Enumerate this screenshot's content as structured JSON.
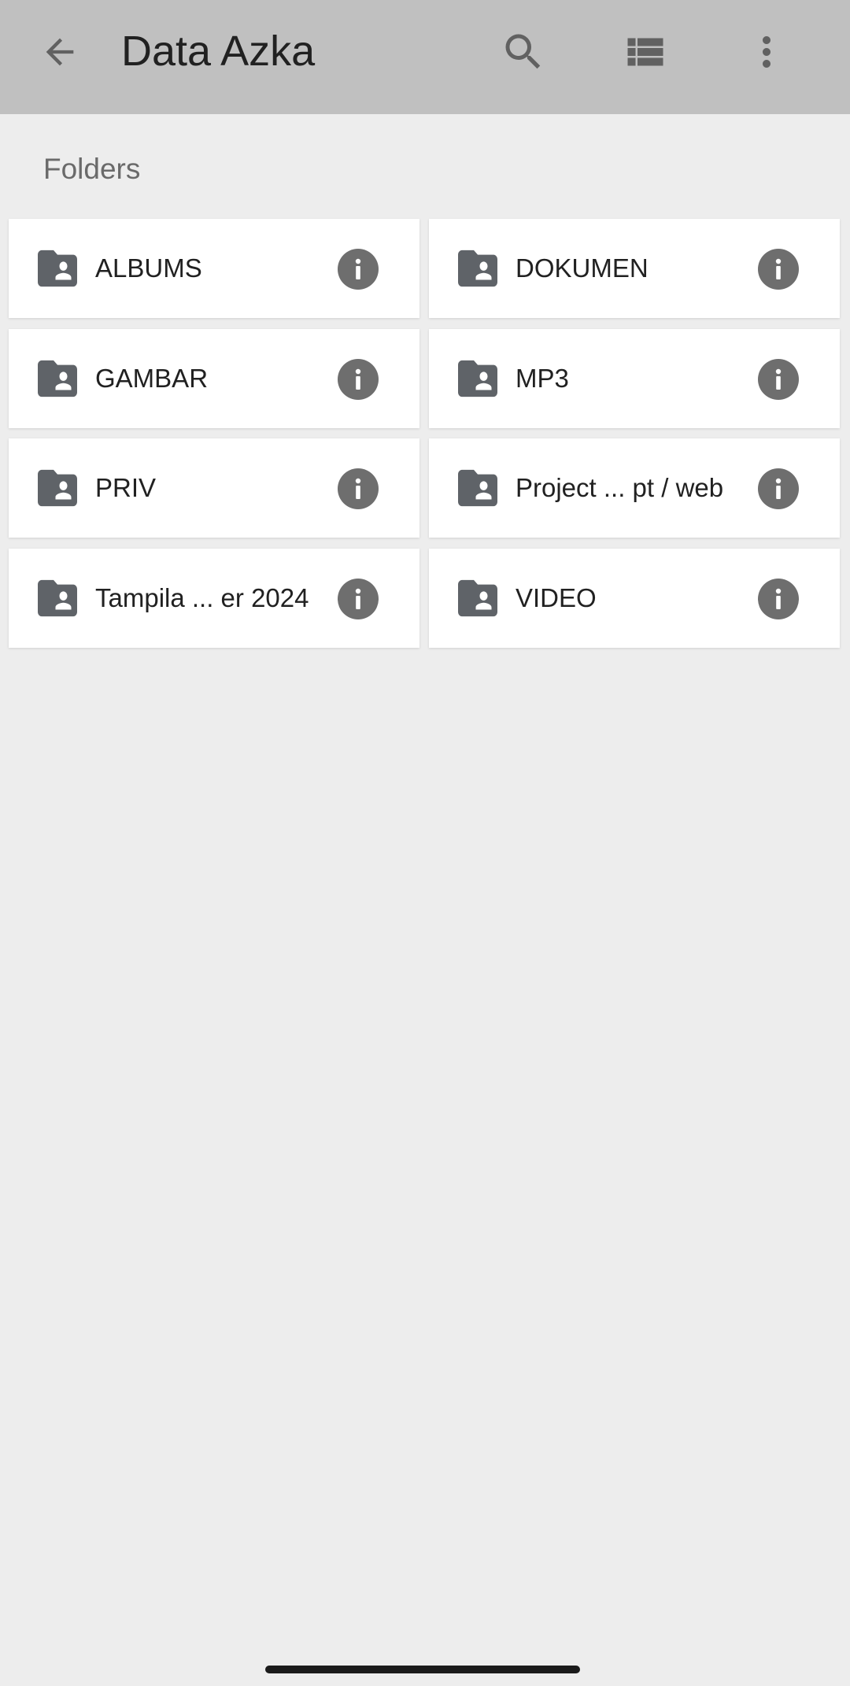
{
  "header": {
    "title": "Data Azka",
    "back_icon": "arrow-left-icon",
    "search_icon": "search-icon",
    "view_icon": "list-view-icon",
    "more_icon": "more-vertical-icon",
    "background_color": "#c0c0c0"
  },
  "section": {
    "label": "Folders"
  },
  "folders": [
    {
      "label": "ALBUMS",
      "icon": "shared-folder-icon",
      "info_icon": "info-icon"
    },
    {
      "label": "DOKUMEN",
      "icon": "shared-folder-icon",
      "info_icon": "info-icon"
    },
    {
      "label": "GAMBAR",
      "icon": "shared-folder-icon",
      "info_icon": "info-icon"
    },
    {
      "label": "MP3",
      "icon": "shared-folder-icon",
      "info_icon": "info-icon"
    },
    {
      "label": "PRIV",
      "icon": "shared-folder-icon",
      "info_icon": "info-icon"
    },
    {
      "label": "Project ... pt / web",
      "icon": "shared-folder-icon",
      "info_icon": "info-icon"
    },
    {
      "label": "Tampila ... er 2024",
      "icon": "shared-folder-icon",
      "info_icon": "info-icon"
    },
    {
      "label": "VIDEO",
      "icon": "shared-folder-icon",
      "info_icon": "info-icon"
    }
  ],
  "colors": {
    "page_background": "#ededed",
    "card_background": "#ffffff",
    "icon_gray": "#5f6368",
    "info_gray": "#6e6e6e"
  }
}
